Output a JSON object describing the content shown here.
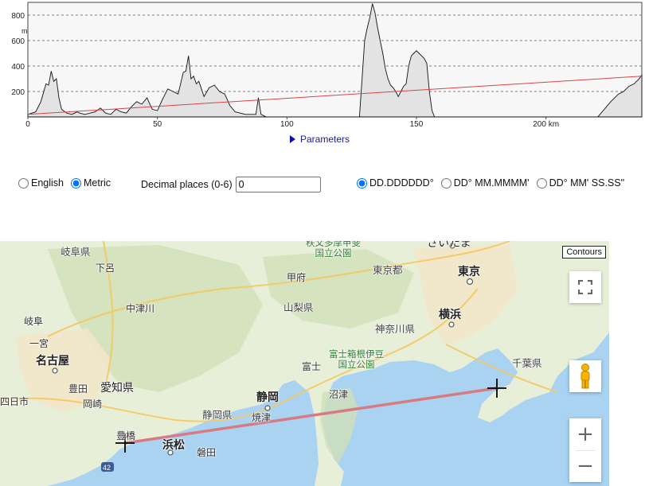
{
  "chart_data": {
    "type": "area",
    "yunit_label": "m",
    "xunit_label": "km",
    "xlim": [
      0,
      237
    ],
    "ylim": [
      0,
      900
    ],
    "y_ticks": [
      200,
      400,
      600,
      800
    ],
    "y_tick_labels": [
      "200",
      "400",
      "600",
      "800"
    ],
    "x_ticks": [
      0,
      50,
      100,
      150,
      200
    ],
    "x_tick_labels": [
      "0",
      "50",
      "100",
      "150",
      "200 km"
    ],
    "grid": "dashed-horizontal",
    "series": [
      {
        "kind": "elevation-profile",
        "x": [
          0,
          3,
          5,
          7,
          8,
          9,
          10,
          11,
          12,
          13,
          15,
          17,
          18,
          19,
          20,
          22,
          24,
          26,
          28,
          30,
          32,
          34,
          36,
          38,
          40,
          42,
          44,
          46,
          48,
          50,
          52,
          54,
          56,
          58,
          60,
          61,
          62,
          63,
          64,
          65,
          66,
          67,
          68,
          70,
          72,
          74,
          76,
          78,
          80,
          82,
          84,
          86,
          88,
          89,
          90,
          92,
          94,
          100,
          110,
          120,
          128,
          129,
          130,
          131,
          132,
          133,
          134,
          135,
          136,
          137,
          138,
          139,
          140,
          141,
          142,
          143,
          144,
          145,
          146,
          147,
          148,
          149,
          150,
          151,
          152,
          153,
          154,
          155,
          156,
          157,
          158,
          160,
          170,
          180,
          200,
          220,
          225,
          228,
          230,
          232,
          234,
          236,
          237
        ],
        "y": [
          20,
          40,
          120,
          260,
          250,
          360,
          280,
          300,
          150,
          60,
          30,
          20,
          30,
          40,
          30,
          20,
          30,
          40,
          70,
          30,
          20,
          60,
          40,
          30,
          80,
          120,
          100,
          150,
          60,
          50,
          140,
          220,
          200,
          180,
          350,
          360,
          480,
          300,
          320,
          260,
          280,
          220,
          160,
          230,
          250,
          200,
          180,
          90,
          40,
          30,
          20,
          20,
          20,
          150,
          20,
          0,
          0,
          0,
          0,
          0,
          0,
          300,
          600,
          700,
          780,
          890,
          820,
          700,
          600,
          500,
          380,
          300,
          250,
          230,
          200,
          160,
          200,
          240,
          260,
          400,
          480,
          500,
          520,
          500,
          480,
          460,
          420,
          200,
          50,
          0,
          0,
          0,
          0,
          0,
          0,
          0,
          120,
          180,
          200,
          240,
          260,
          300,
          330
        ]
      },
      {
        "kind": "line-of-sight",
        "x": [
          0,
          237
        ],
        "y": [
          20,
          320
        ],
        "color": "#d64545"
      }
    ]
  },
  "parameters": {
    "label": "Parameters"
  },
  "units": {
    "english_label": "English",
    "metric_label": "Metric",
    "selected": "Metric"
  },
  "decimal": {
    "label": "Decimal places (0-6)",
    "value": "0"
  },
  "coord_format": {
    "options": [
      "DD.DDDDDD°",
      "DD° MM.MMMM'",
      "DD° MM' SS.SS\""
    ],
    "selected": "DD.DDDDDD°"
  },
  "map": {
    "contours_label": "Contours",
    "labels": {
      "gifu": "岐阜県",
      "shimoro": "下呂",
      "nakatsugawa": "中津川",
      "gifu_city": "岐阜",
      "ichinomiya": "一宮",
      "nagoya": "名古屋",
      "aichi": "愛知県",
      "toyota": "豊田",
      "okazaki": "岡崎",
      "yokkaichi": "四日市",
      "toyohashi": "豊橋",
      "hamamatsu": "浜松",
      "iwata": "磐田",
      "shizuoka": "静岡",
      "shizuoka_pref": "静岡県",
      "yaizu": "焼津",
      "numazu": "沼津",
      "fuji": "富士",
      "fuji_park": "富士箱根伊豆\n国立公園",
      "yamanashi": "山梨県",
      "kofu": "甲府",
      "chichibu_park": "秩父多摩甲斐\n国立公園",
      "tokyo_pref": "東京都",
      "tokyo": "東京",
      "kanagawa": "神奈川県",
      "yokohama": "横浜",
      "chiba": "千葉県",
      "saitama": "さいたま",
      "route": "42"
    }
  },
  "colors": {
    "profile_fill": "#e3e3e3",
    "profile_line": "#111111",
    "sight_line": "#d64545",
    "path_line": "#d97a82",
    "sea": "#a9d3f1",
    "land": "#e8efd9"
  }
}
